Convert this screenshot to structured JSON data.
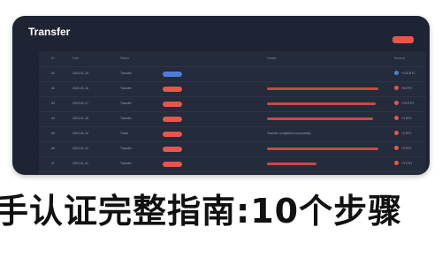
{
  "window": {
    "title": "Transfer",
    "accent_color": "#e8564a"
  },
  "table": {
    "headers": [
      "ID",
      "Date",
      "Status",
      "",
      "",
      "Details",
      "Amount"
    ],
    "rows": [
      {
        "id": "#1",
        "date": "2023-01-15",
        "name": "Transfer",
        "status_color": "#4a7fd6",
        "bar_fraction": 0,
        "detail": "",
        "dot_color": "#4a7fd6",
        "amount": "+120 BTC"
      },
      {
        "id": "#2",
        "date": "2023-01-16",
        "name": "Transfer",
        "status_color": "#e8564a",
        "bar_fraction": 0.9,
        "detail": "",
        "dot_color": "#e8564a",
        "amount": "+8 ETH"
      },
      {
        "id": "#3",
        "date": "2023-01-17",
        "name": "Transfer",
        "status_color": "#e8564a",
        "bar_fraction": 0.88,
        "detail": "",
        "dot_color": "#e8564a",
        "amount": "+15 ETH"
      },
      {
        "id": "#4",
        "date": "2023-01-18",
        "name": "Transfer",
        "status_color": "#e8564a",
        "bar_fraction": 0.86,
        "detail": "",
        "dot_color": "#e8564a",
        "amount": "+4 BTC"
      },
      {
        "id": "#5",
        "date": "2023-01-19",
        "name": "Trade",
        "status_color": "#e8564a",
        "bar_fraction": 0,
        "detail": "Transfer completed successfully",
        "dot_color": "#e8564a",
        "amount": "+2 BTC"
      },
      {
        "id": "#6",
        "date": "2023-01-20",
        "name": "Transfer",
        "status_color": "#e8564a",
        "bar_fraction": 0.9,
        "detail": "",
        "dot_color": "#e8564a",
        "amount": "+9 BTC"
      },
      {
        "id": "#7",
        "date": "2023-01-21",
        "name": "Transfer",
        "status_color": "#e8564a",
        "bar_fraction": 0.4,
        "detail": "",
        "dot_color": "#e8564a",
        "amount": "+3 ETH"
      }
    ]
  },
  "overlay": {
    "text": "手认证完整指南:10个步骤"
  }
}
